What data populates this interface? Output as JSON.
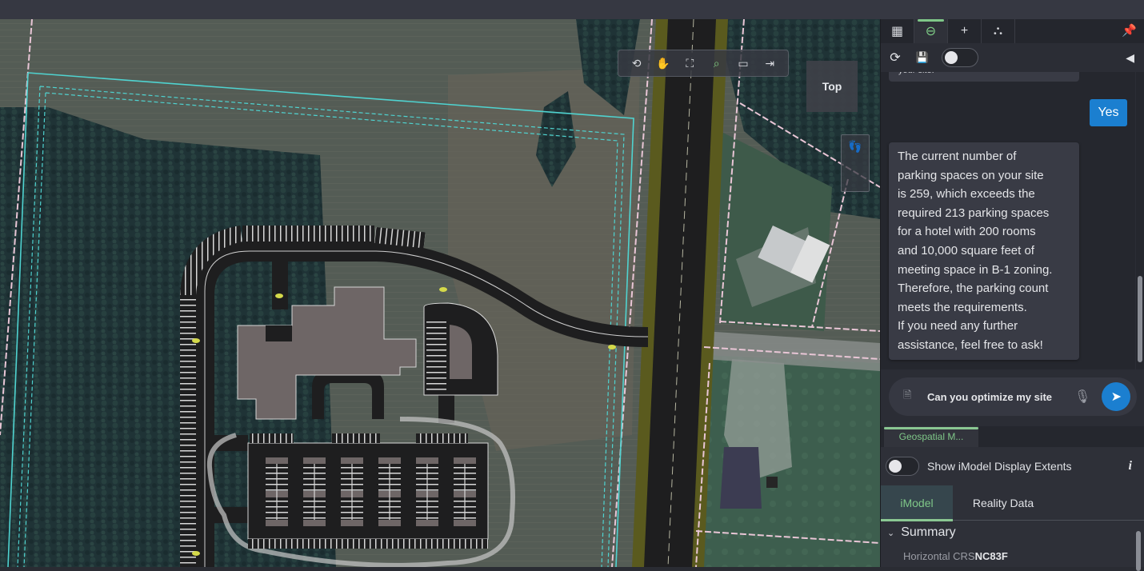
{
  "viewport": {
    "toolbar": [
      {
        "name": "rotate-view-icon",
        "glyph": "⟲"
      },
      {
        "name": "pan-hand-icon",
        "glyph": "✋"
      },
      {
        "name": "fit-view-icon",
        "glyph": "⛶"
      },
      {
        "name": "zoom-window-icon",
        "glyph": "⌕"
      },
      {
        "name": "window-area-icon",
        "glyph": "▭"
      },
      {
        "name": "collapse-toolbar-icon",
        "glyph": "⇥"
      }
    ],
    "view_cube_label": "Top",
    "walk_icon": "👣",
    "colors": {
      "parcel_boundary": "#4fd3d0",
      "property_line": "#e9c6d6",
      "pavement": "#1e1e1f",
      "building": "#6e6666",
      "road_shoulder": "#5a5a1e"
    }
  },
  "panel": {
    "tabs": [
      {
        "name": "tab-documents",
        "glyph": "▦"
      },
      {
        "name": "tab-chat",
        "glyph": "⊖",
        "active": true
      },
      {
        "name": "tab-add",
        "glyph": "+"
      },
      {
        "name": "tab-hierarchy",
        "glyph": "⛬"
      }
    ],
    "pin_glyph": "📌",
    "controls": {
      "refresh_glyph": "⟳",
      "save_glyph": "💾",
      "speaker_glyph": "◀"
    },
    "chat": {
      "previous_bubble_tail": "your site.",
      "user_reply": "Yes",
      "assistant_message_lines": [
        "The current number of",
        "parking spaces on your site",
        "is 259, which exceeds the",
        "required 213 parking spaces",
        "for a hotel with 200 rooms",
        "and 10,000 square feet of",
        "meeting space in B-1 zoning.",
        "Therefore, the parking count",
        "meets the requirements.",
        "If you need any further",
        "assistance, feel free to ask!"
      ],
      "input_value": "Can you optimize my site",
      "attach_glyph": "🗎",
      "mic_glyph": "🎙",
      "send_glyph": "➤"
    },
    "geospatial": {
      "tab_label": "Geospatial M...",
      "extents_label": "Show iModel Display Extents",
      "info_glyph": "i",
      "sub_tabs": [
        "iModel",
        "Reality Data"
      ],
      "summary_label": "Summary",
      "crs_label": "Horizontal CRS",
      "crs_value": "NC83F"
    }
  }
}
